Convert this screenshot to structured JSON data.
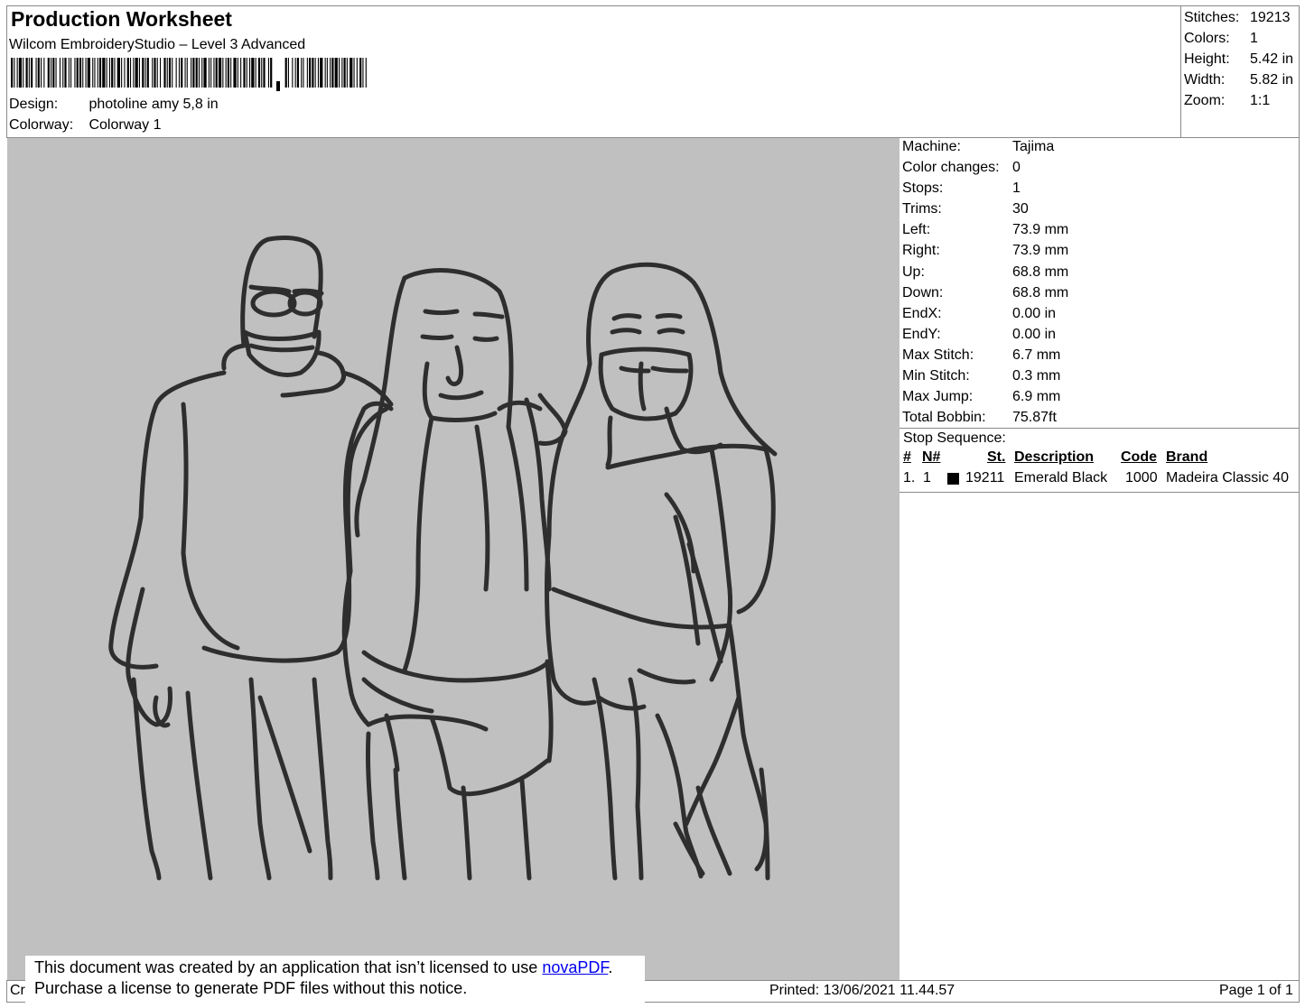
{
  "header": {
    "title": "Production Worksheet",
    "subtitle": "Wilcom EmbroideryStudio – Level 3 Advanced",
    "design_label": "Design:",
    "design_value": "photoline amy 5,8 in",
    "colorway_label": "Colorway:",
    "colorway_value": "Colorway 1"
  },
  "summary": [
    {
      "label": "Stitches:",
      "value": "19213"
    },
    {
      "label": "Colors:",
      "value": "1"
    },
    {
      "label": "Height:",
      "value": "5.42 in"
    },
    {
      "label": "Width:",
      "value": "5.82 in"
    },
    {
      "label": "Zoom:",
      "value": "1:1"
    }
  ],
  "machine_stats": [
    {
      "label": "Machine:",
      "value": "Tajima"
    },
    {
      "label": "Color changes:",
      "value": "0"
    },
    {
      "label": "Stops:",
      "value": "1"
    },
    {
      "label": "Trims:",
      "value": "30"
    },
    {
      "label": "Left:",
      "value": "73.9 mm"
    },
    {
      "label": "Right:",
      "value": "73.9 mm"
    },
    {
      "label": "Up:",
      "value": "68.8 mm"
    },
    {
      "label": "Down:",
      "value": "68.8 mm"
    },
    {
      "label": "EndX:",
      "value": "0.00 in"
    },
    {
      "label": "EndY:",
      "value": "0.00 in"
    },
    {
      "label": "Max Stitch:",
      "value": "6.7 mm"
    },
    {
      "label": "Min Stitch:",
      "value": "0.3 mm"
    },
    {
      "label": "Max Jump:",
      "value": "6.9 mm"
    },
    {
      "label": "Total Bobbin:",
      "value": "75.87ft"
    }
  ],
  "stop_sequence": {
    "title": "Stop Sequence:",
    "headers": {
      "num": "#",
      "needle": "N#",
      "stitches": "St.",
      "description": "Description",
      "code": "Code",
      "brand": "Brand"
    },
    "rows": [
      {
        "num": "1.",
        "needle": "1",
        "swatch_color": "#000000",
        "stitches": "19211",
        "description": "Emerald Black",
        "code": "1000",
        "brand": "Madeira Classic 40"
      }
    ]
  },
  "colors": {
    "canvas_bg": "#c0c0c0",
    "thread": "#2e2e2e"
  },
  "notice": {
    "line1_prefix": "This document was created by an application that isn’t licensed to use ",
    "link_text": "novaPDF",
    "line1_suffix": ".",
    "line2": "Purchase a license to generate PDF files without this notice."
  },
  "footer": {
    "left_fragment": "Cr",
    "printed": "Printed: 13/06/2021 11.44.57",
    "page": "Page 1 of 1"
  }
}
